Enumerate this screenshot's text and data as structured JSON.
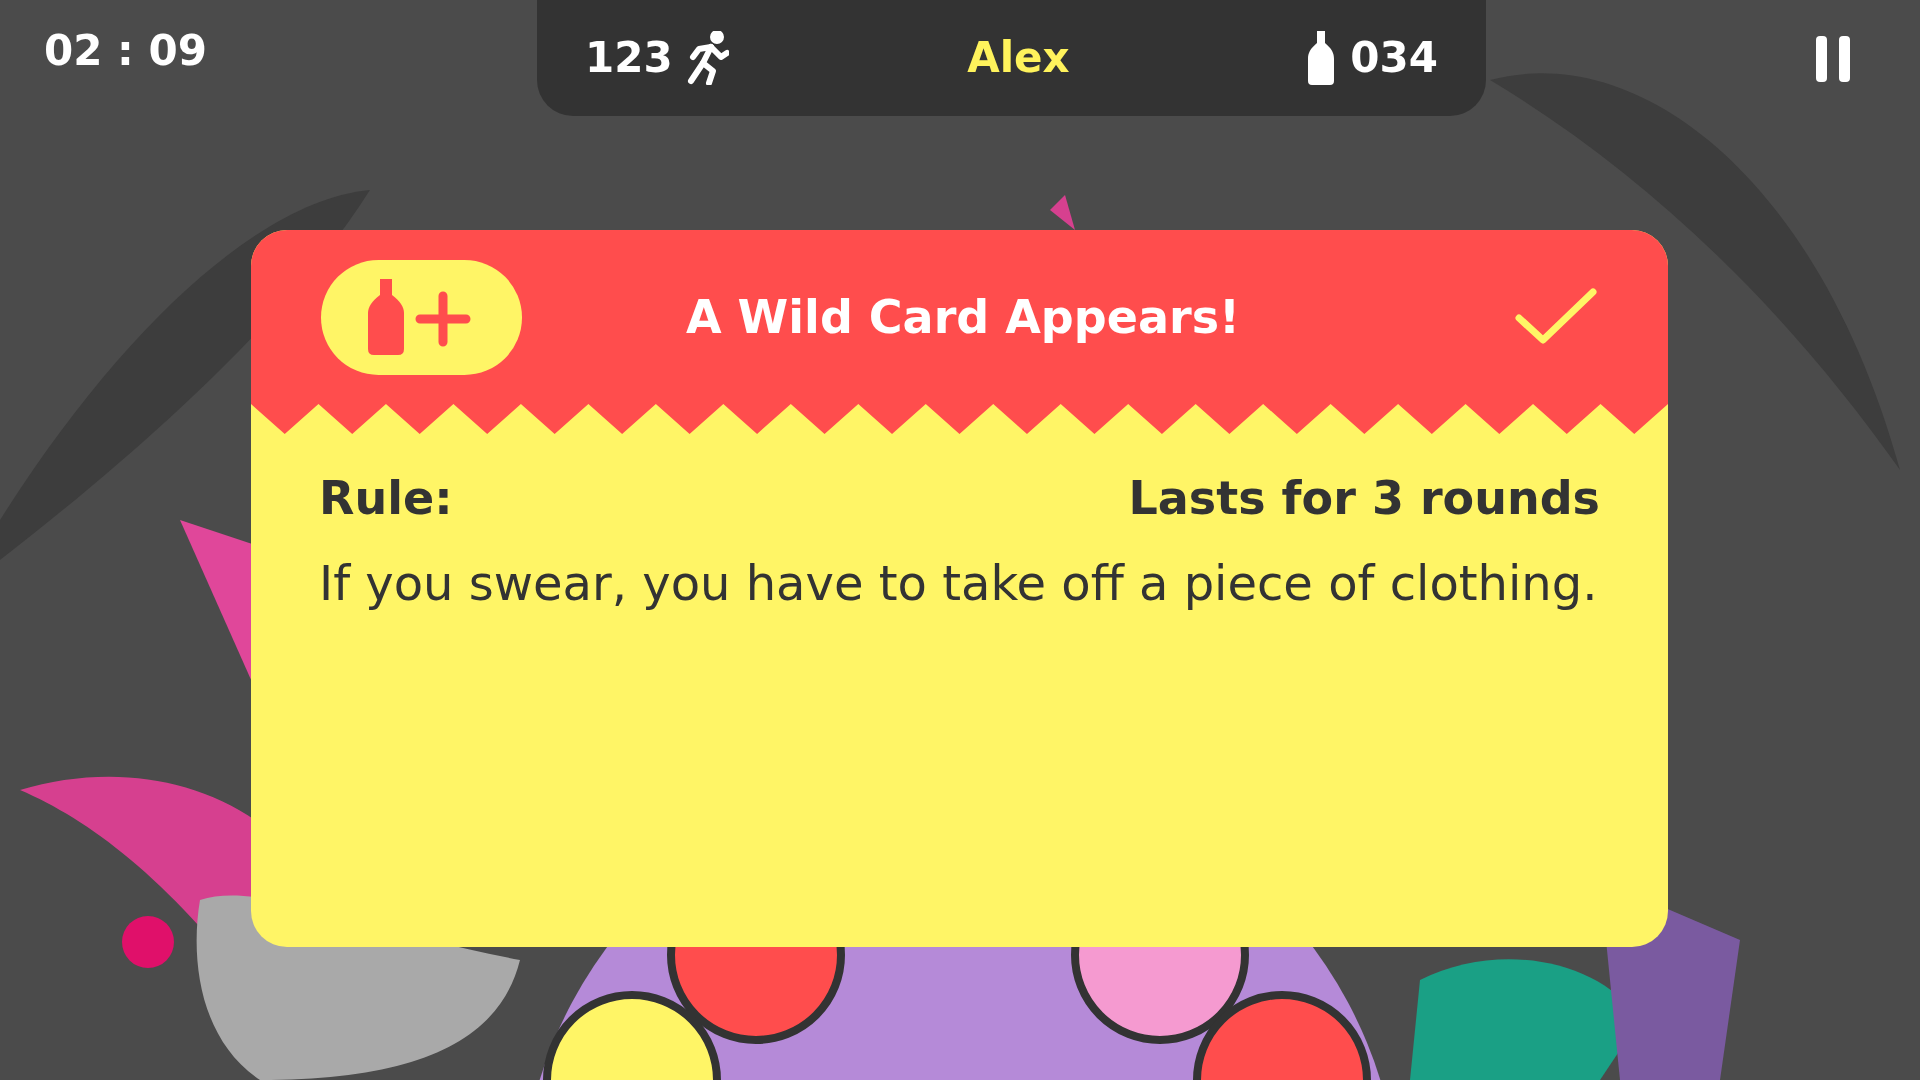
{
  "timer": "02 : 09",
  "hud": {
    "score": "123",
    "player": "Alex",
    "drinks": "034"
  },
  "card": {
    "title": "A Wild Card Appears!",
    "rule_label": "Rule:",
    "duration": "Lasts for 3 rounds",
    "rule_text": "If you swear, you have to take off a piece of clothing."
  }
}
